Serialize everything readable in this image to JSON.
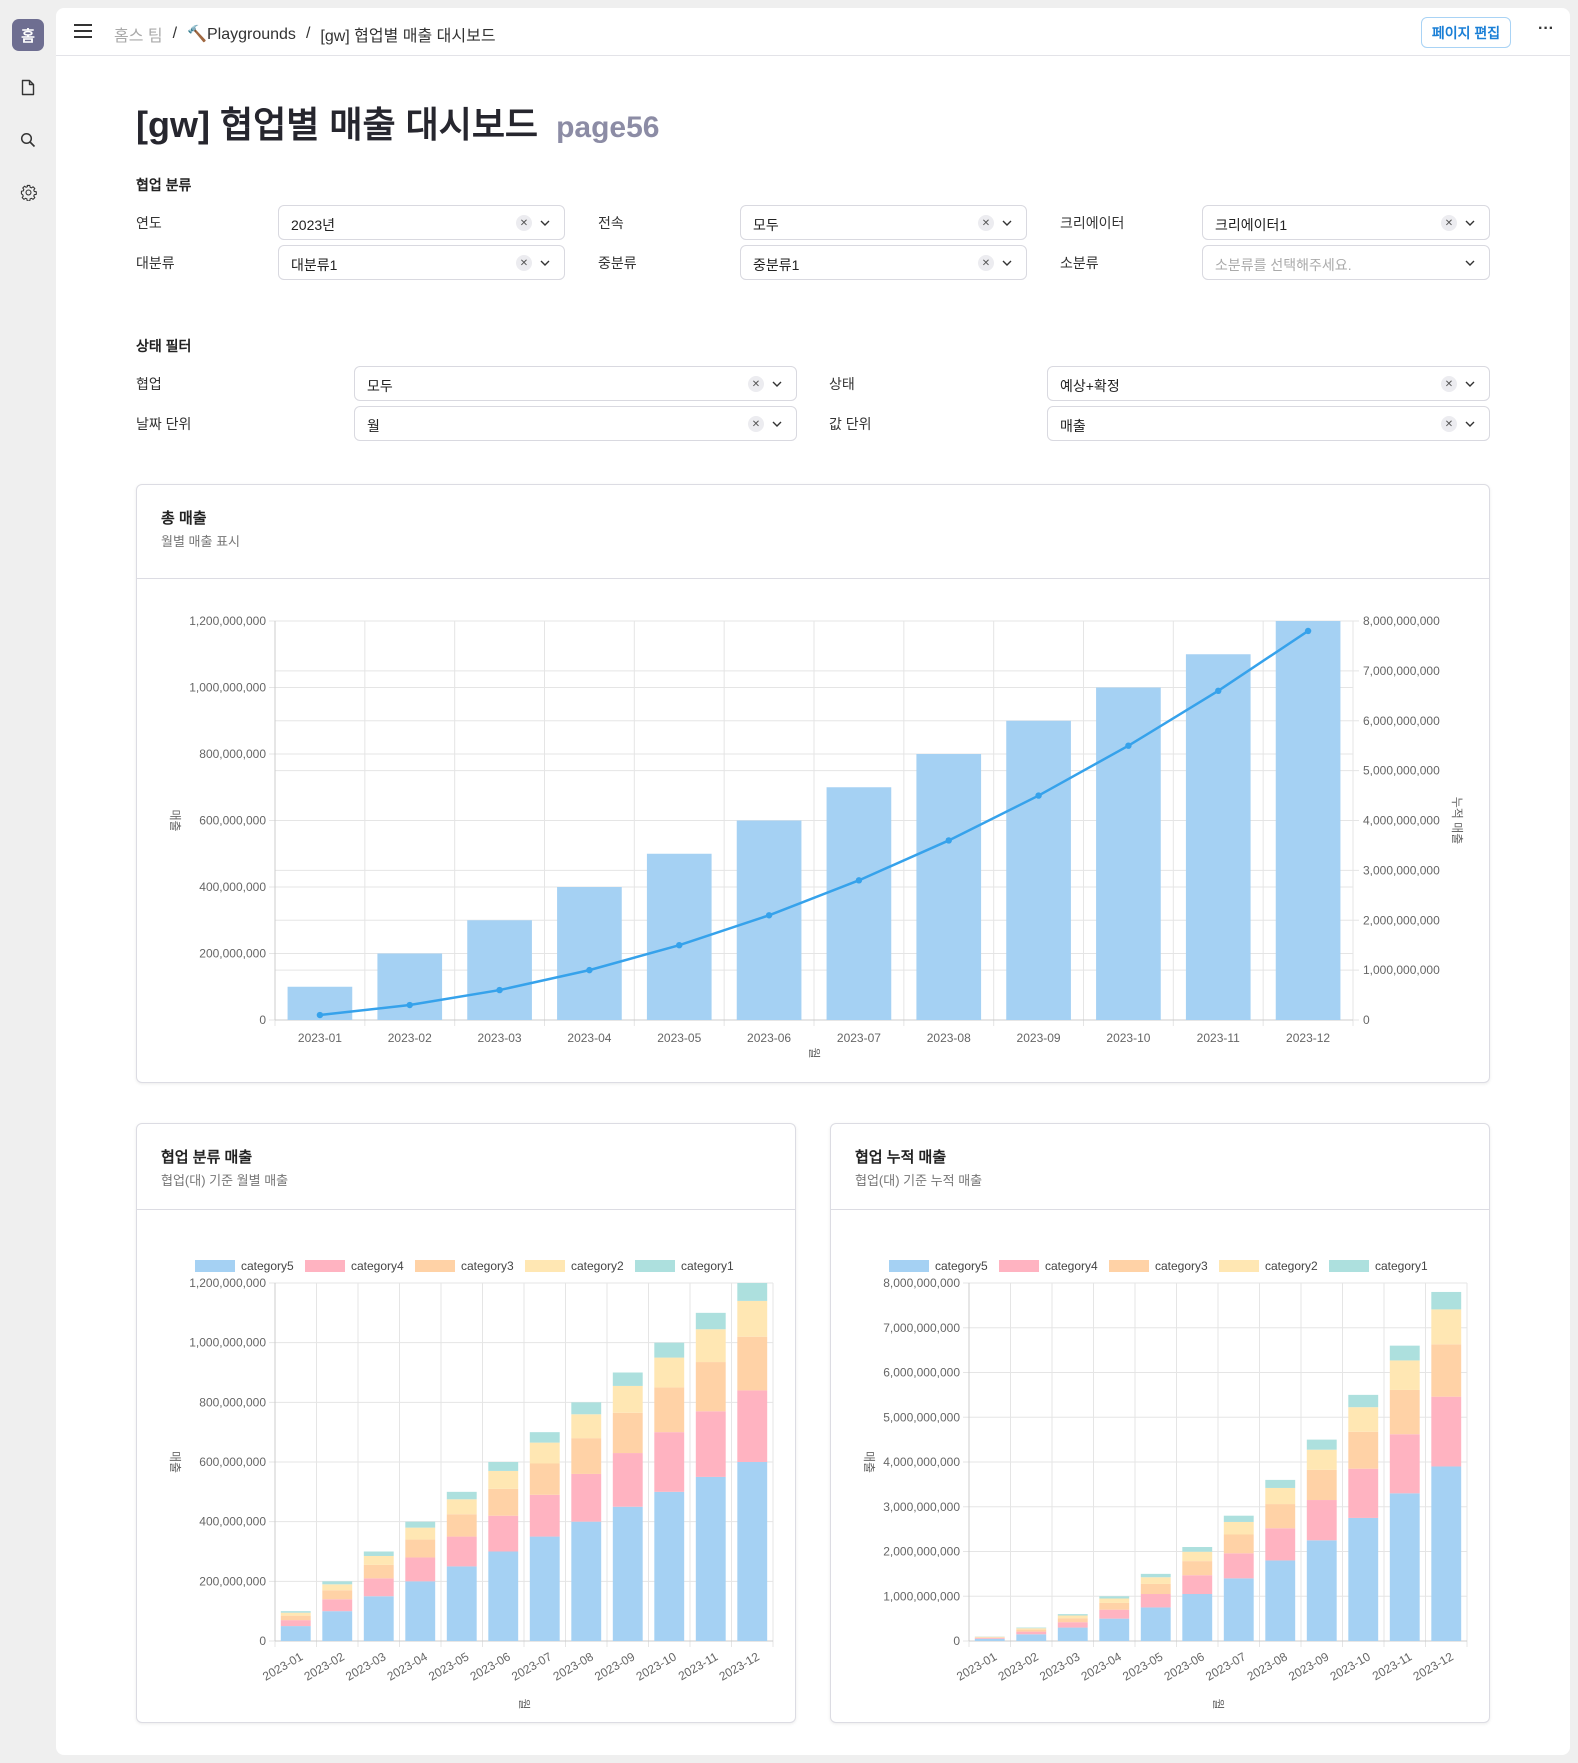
{
  "sidebar": {
    "home_badge": "홈",
    "items": [
      {
        "icon": "document-icon"
      },
      {
        "icon": "search-icon"
      },
      {
        "icon": "gear-icon"
      }
    ]
  },
  "topbar": {
    "breadcrumb": [
      {
        "label": "홈스 팀",
        "muted": true
      },
      {
        "label": "🔨Playgrounds",
        "muted": false
      },
      {
        "label": "[gw] 협업별 매출 대시보드",
        "muted": false
      }
    ],
    "separator": "/",
    "edit_button": "페이지 편집",
    "more_button": "···"
  },
  "page": {
    "title": "[gw] 협업별 매출 대시보드",
    "subtitle": "page56"
  },
  "filters_category": {
    "section_label": "협업 분류",
    "fields": [
      {
        "label": "연도",
        "value": "2023년",
        "placeholder": "",
        "clearable": true
      },
      {
        "label": "전속",
        "value": "모두",
        "placeholder": "",
        "clearable": true
      },
      {
        "label": "크리에이터",
        "value": "크리에이터1",
        "placeholder": "",
        "clearable": true
      },
      {
        "label": "대분류",
        "value": "대분류1",
        "placeholder": "",
        "clearable": true
      },
      {
        "label": "중분류",
        "value": "중분류1",
        "placeholder": "",
        "clearable": true
      },
      {
        "label": "소분류",
        "value": "",
        "placeholder": "소분류를 선택해주세요.",
        "clearable": false
      }
    ]
  },
  "filters_status": {
    "section_label": "상태 필터",
    "fields": [
      {
        "label": "협업",
        "value": "모두",
        "clearable": true
      },
      {
        "label": "상태",
        "value": "예상+확정",
        "clearable": true
      },
      {
        "label": "날짜 단위",
        "value": "월",
        "clearable": true
      },
      {
        "label": "값 단위",
        "value": "매출",
        "clearable": true
      }
    ]
  },
  "cards": {
    "total": {
      "title": "총 매출",
      "subtitle": "월별 매출 표시"
    },
    "category": {
      "title": "협업 분류 매출",
      "subtitle": "협업(대) 기준 월별 매출"
    },
    "cumulative": {
      "title": "협업 누적 매출",
      "subtitle": "협업(대) 기준 누적 매출"
    }
  },
  "colors": {
    "bar_total": "#a5d1f3",
    "line_cumulative": "#36a2eb",
    "category5": "#a5d1f3",
    "category4": "#ffb3c1",
    "category3": "#ffd2a6",
    "category2": "#ffe7b3",
    "category1": "#ade0de",
    "grid": "#e5e5e5",
    "tick_text": "#666666"
  },
  "chart_data": [
    {
      "type": "bar",
      "title": "총 매출",
      "categories": [
        "2023-01",
        "2023-02",
        "2023-03",
        "2023-04",
        "2023-05",
        "2023-06",
        "2023-07",
        "2023-08",
        "2023-09",
        "2023-10",
        "2023-11",
        "2023-12"
      ],
      "series": [
        {
          "name": "매출",
          "type": "bar",
          "axis": "left",
          "values": [
            100000000,
            200000000,
            300000000,
            400000000,
            500000000,
            600000000,
            700000000,
            800000000,
            900000000,
            1000000000,
            1100000000,
            1200000000
          ]
        },
        {
          "name": "누적 매출",
          "type": "line",
          "axis": "right",
          "values": [
            100000000,
            300000000,
            600000000,
            1000000000,
            1500000000,
            2100000000,
            2800000000,
            3600000000,
            4500000000,
            5500000000,
            6600000000,
            7800000000
          ]
        }
      ],
      "xlabel": "월",
      "ylabel": "매출",
      "y2label": "누적 매출",
      "ylim": [
        0,
        1200000000
      ],
      "y_ticks": [
        "0",
        "200,000,000",
        "400,000,000",
        "600,000,000",
        "800,000,000",
        "1,000,000,000",
        "1,200,000,000"
      ],
      "y2lim": [
        0,
        8000000000
      ],
      "y2_ticks": [
        "0",
        "1,000,000,000",
        "2,000,000,000",
        "3,000,000,000",
        "4,000,000,000",
        "5,000,000,000",
        "6,000,000,000",
        "7,000,000,000",
        "8,000,000,000"
      ],
      "grid": true,
      "legend": "none"
    },
    {
      "type": "bar",
      "stacked": true,
      "title": "협업 분류 매출",
      "categories": [
        "2023-01",
        "2023-02",
        "2023-03",
        "2023-04",
        "2023-05",
        "2023-06",
        "2023-07",
        "2023-08",
        "2023-09",
        "2023-10",
        "2023-11",
        "2023-12"
      ],
      "series": [
        {
          "name": "category5",
          "values": [
            50000000,
            100000000,
            150000000,
            200000000,
            250000000,
            300000000,
            350000000,
            400000000,
            450000000,
            500000000,
            550000000,
            600000000
          ]
        },
        {
          "name": "category4",
          "values": [
            20000000,
            40000000,
            60000000,
            80000000,
            100000000,
            120000000,
            140000000,
            160000000,
            180000000,
            200000000,
            220000000,
            240000000
          ]
        },
        {
          "name": "category3",
          "values": [
            15000000,
            30000000,
            45000000,
            60000000,
            75000000,
            90000000,
            105000000,
            120000000,
            135000000,
            150000000,
            165000000,
            180000000
          ]
        },
        {
          "name": "category2",
          "values": [
            10000000,
            20000000,
            30000000,
            40000000,
            50000000,
            60000000,
            70000000,
            80000000,
            90000000,
            100000000,
            110000000,
            120000000
          ]
        },
        {
          "name": "category1",
          "values": [
            5000000,
            10000000,
            15000000,
            20000000,
            25000000,
            30000000,
            35000000,
            40000000,
            45000000,
            50000000,
            55000000,
            60000000
          ]
        }
      ],
      "xlabel": "월",
      "ylabel": "매출",
      "ylim": [
        0,
        1200000000
      ],
      "y_ticks": [
        "0",
        "200,000,000",
        "400,000,000",
        "600,000,000",
        "800,000,000",
        "1,000,000,000",
        "1,200,000,000"
      ],
      "grid": true,
      "legend": "top"
    },
    {
      "type": "bar",
      "stacked": true,
      "title": "협업 누적 매출",
      "categories": [
        "2023-01",
        "2023-02",
        "2023-03",
        "2023-04",
        "2023-05",
        "2023-06",
        "2023-07",
        "2023-08",
        "2023-09",
        "2023-10",
        "2023-11",
        "2023-12"
      ],
      "series": [
        {
          "name": "category5",
          "values": [
            50000000,
            150000000,
            300000000,
            500000000,
            750000000,
            1050000000,
            1400000000,
            1800000000,
            2250000000,
            2750000000,
            3300000000,
            3900000000
          ]
        },
        {
          "name": "category4",
          "values": [
            20000000,
            60000000,
            120000000,
            200000000,
            300000000,
            420000000,
            560000000,
            720000000,
            900000000,
            1100000000,
            1320000000,
            1560000000
          ]
        },
        {
          "name": "category3",
          "values": [
            15000000,
            45000000,
            90000000,
            150000000,
            225000000,
            315000000,
            420000000,
            540000000,
            675000000,
            825000000,
            990000000,
            1170000000
          ]
        },
        {
          "name": "category2",
          "values": [
            10000000,
            30000000,
            60000000,
            100000000,
            150000000,
            210000000,
            280000000,
            360000000,
            450000000,
            550000000,
            660000000,
            780000000
          ]
        },
        {
          "name": "category1",
          "values": [
            5000000,
            15000000,
            30000000,
            50000000,
            75000000,
            105000000,
            140000000,
            180000000,
            225000000,
            275000000,
            330000000,
            390000000
          ]
        }
      ],
      "xlabel": "월",
      "ylabel": "매출",
      "ylim": [
        0,
        8000000000
      ],
      "y_ticks": [
        "0",
        "1,000,000,000",
        "2,000,000,000",
        "3,000,000,000",
        "4,000,000,000",
        "5,000,000,000",
        "6,000,000,000",
        "7,000,000,000",
        "8,000,000,000"
      ],
      "grid": true,
      "legend": "top"
    }
  ]
}
